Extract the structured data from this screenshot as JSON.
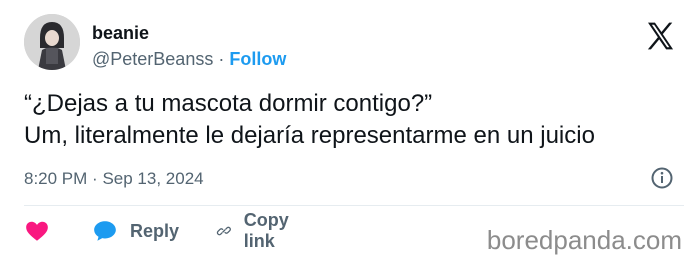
{
  "user": {
    "display_name": "beanie",
    "handle": "@PeterBeanss",
    "separator": "·",
    "follow_label": "Follow"
  },
  "tweet": {
    "lines": [
      "“¿Dejas a tu mascota dormir contigo?”",
      "Um, literalmente le dejaría representarme en un juicio"
    ],
    "time": "8:20 PM",
    "date": "Sep 13, 2024",
    "meta_separator": "·"
  },
  "actions": {
    "reply_label": "Reply",
    "copy_link_label": "Copy link"
  },
  "watermark": "boredpanda.com",
  "icons": {
    "brand": "x-logo-icon",
    "info": "info-icon",
    "like": "heart-icon",
    "reply": "speech-bubble-icon",
    "copy": "link-icon"
  },
  "colors": {
    "text": "#0f1419",
    "secondary": "#536471",
    "follow": "#1d9bf0",
    "heart": "#f91880",
    "reply_bubble": "#1d9bf0"
  }
}
